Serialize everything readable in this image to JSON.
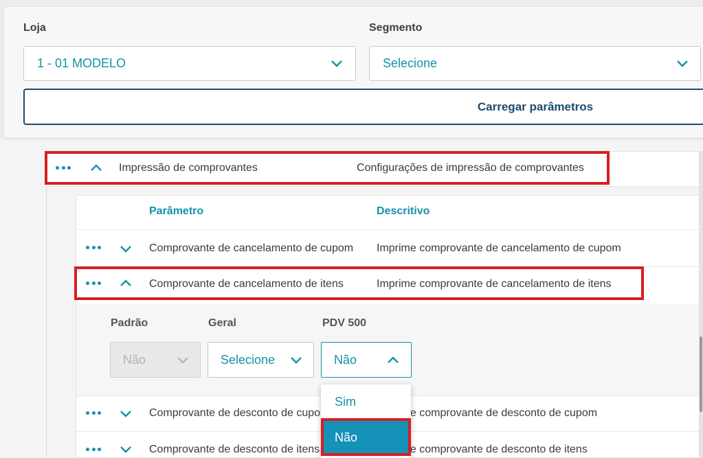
{
  "filters": {
    "loja_label": "Loja",
    "loja_value": "1 - 01 MODELO",
    "segmento_label": "Segmento",
    "segmento_value": "Selecione",
    "load_button": "Carregar parâmetros"
  },
  "group": {
    "name": "Impressão de comprovantes",
    "description": "Configurações de impressão de comprovantes"
  },
  "table": {
    "col_param": "Parâmetro",
    "col_desc": "Descritivo",
    "rows": [
      {
        "param": "Comprovante de cancelamento de cupom",
        "desc": "Imprime comprovante de cancelamento de cupom"
      },
      {
        "param": "Comprovante de cancelamento de itens",
        "desc": "Imprime comprovante de cancelamento de itens"
      },
      {
        "param": "Comprovante de desconto de cupom",
        "desc": "Imprime comprovante de desconto de cupom"
      },
      {
        "param": "Comprovante de desconto de itens",
        "desc": "Imprime comprovante de desconto de itens"
      }
    ]
  },
  "detail": {
    "padrao_label": "Padrão",
    "padrao_value": "Não",
    "geral_label": "Geral",
    "geral_value": "Selecione",
    "pdv_label": "PDV 500",
    "pdv_value": "Não"
  },
  "dropdown": {
    "options": [
      "Sim",
      "Não"
    ],
    "selected": "Não"
  },
  "colors": {
    "accent": "#1492a8",
    "highlight": "#d81e21",
    "button_border": "#1c4a6d"
  }
}
